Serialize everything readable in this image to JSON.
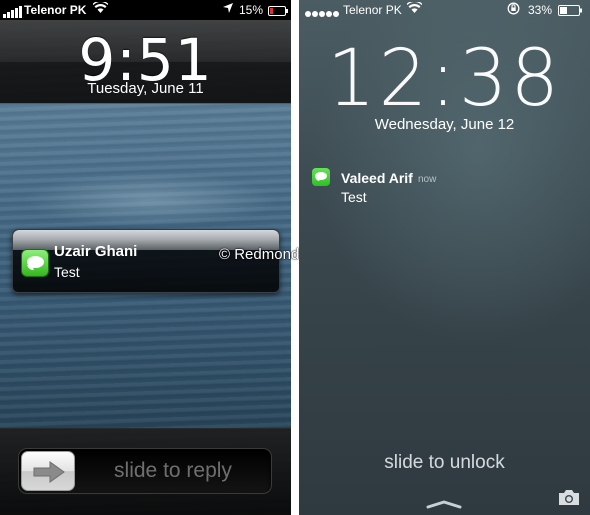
{
  "left_phone": {
    "status_bar": {
      "carrier": "Telenor PK",
      "battery": "15%"
    },
    "time": "9:51",
    "date": "Tuesday, June 11",
    "notification": {
      "sender": "Uzair Ghani",
      "message": "Test",
      "app_icon": "messages-icon"
    },
    "slider": {
      "label": "slide to reply",
      "knob_icon": "arrow-right-icon"
    }
  },
  "watermark": "© RedmondPie.com",
  "right_phone": {
    "status_bar": {
      "carrier": "Telenor PK",
      "battery": "33%"
    },
    "time": "12:38",
    "date": "Wednesday, June 12",
    "notification": {
      "sender": "Valeed Arif",
      "time": "now",
      "message": "Test",
      "app_icon": "messages-icon"
    },
    "unlock_label": "slide to unlock",
    "camera_icon": "camera-icon"
  },
  "colors": {
    "messages_green": "#34b61e",
    "ios7_messages_green": "#2fbf24"
  }
}
